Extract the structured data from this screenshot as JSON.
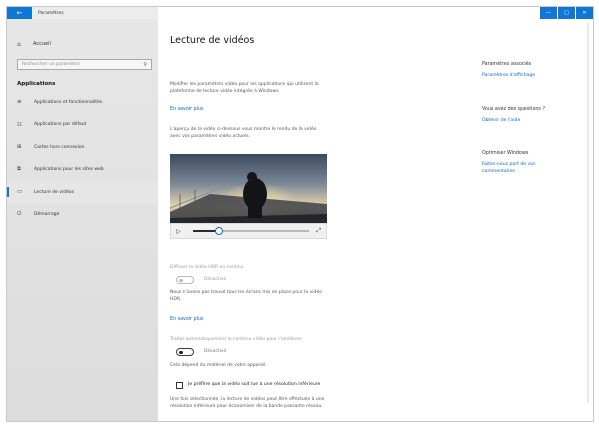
{
  "window": {
    "app_title": "Paramètres",
    "back_label": "←",
    "controls": {
      "minimize": "—",
      "maximize": "□",
      "close": "✕"
    }
  },
  "sidebar": {
    "home_icon": "⌂",
    "home_label": "Accueil",
    "search_placeholder": "Rechercher un paramètre",
    "search_icon": "⚲",
    "section_title": "Applications",
    "items": [
      {
        "icon": "≡",
        "label": "Applications et fonctionnalités"
      },
      {
        "icon": "☷",
        "label": "Applications par défaut"
      },
      {
        "icon": "⊞",
        "label": "Cartes hors connexion"
      },
      {
        "icon": "⧉",
        "label": "Applications pour les sites web"
      },
      {
        "icon": "▭",
        "label": "Lecture de vidéos"
      },
      {
        "icon": "⏻",
        "label": "Démarrage"
      }
    ],
    "active_index": 4
  },
  "main": {
    "title": "Lecture de vidéos",
    "intro_line1": "Modifier les paramètres vidéo pour les applications qui utilisent la",
    "intro_line2": "plateforme de lecture vidéo intégrée à Windows.",
    "learn_more_1": "En savoir plus",
    "preview_line1": "L'aperçu de la vidéo ci-dessous vous montre le rendu de la vidéo",
    "preview_line2": "avec vos paramètres vidéo actuels.",
    "player": {
      "play_icon": "▷",
      "fullscreen_icon": "⤢",
      "progress": 0.22
    },
    "hdr_heading": "Diffuser la vidéo HDR en continu",
    "hdr_toggle_state": "Désactivé",
    "hdr_note_line1": "Nous n'avons pas trouvé tous les écrans mis en place pour la vidéo",
    "hdr_note_line2": "HDR.",
    "learn_more_2": "En savoir plus",
    "auto_heading": "Traiter automatiquement le contenu vidéo pour l'améliorer",
    "auto_toggle_state": "Désactivé",
    "auto_note": "Cela dépend du matériel de votre appareil.",
    "checkbox_label": "Je préfère que la vidéo soit lue à une résolution inférieure",
    "checkbox_note_line1": "Une fois sélectionnée, la lecture de vidéos peut être effectuée à une",
    "checkbox_note_line2": "résolution inférieure pour économiser de la bande passante réseau."
  },
  "right": {
    "related_heading": "Paramètres associés",
    "related_link": "Paramètres d'affichage",
    "questions_heading": "Vous avez des questions ?",
    "questions_link": "Obtenir de l'aide",
    "improve_heading": "Optimiser Windows",
    "improve_link_line1": "Faites-nous part de vos",
    "improve_link_line2": "commentaires"
  }
}
